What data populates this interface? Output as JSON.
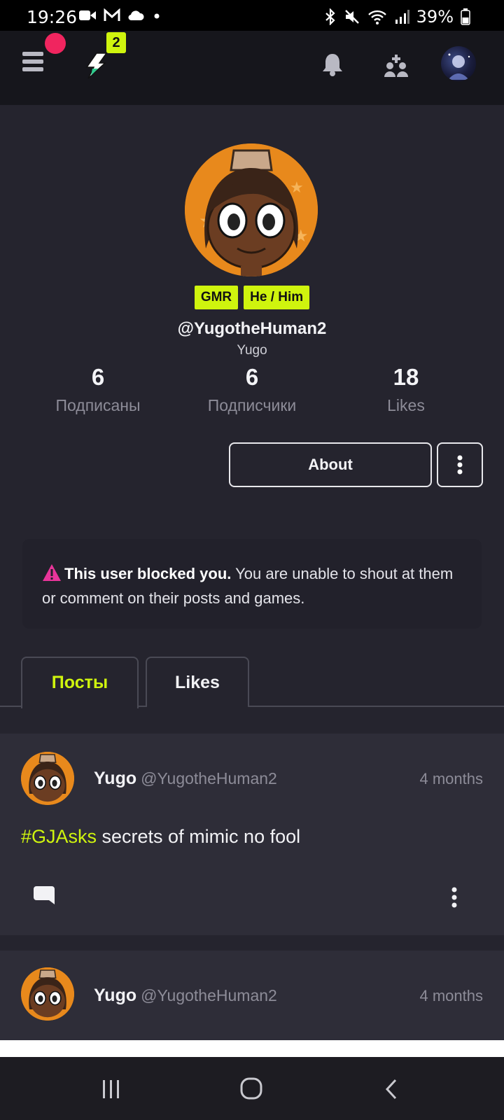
{
  "status_bar": {
    "time": "19:26",
    "battery": "39%"
  },
  "app_header": {
    "notification_badge": "2"
  },
  "profile": {
    "tags": [
      "GMR",
      "He / Him"
    ],
    "handle": "@YugotheHuman2",
    "display_name": "Yugo",
    "stats": [
      {
        "value": "6",
        "label": "Подписаны"
      },
      {
        "value": "6",
        "label": "Подписчики"
      },
      {
        "value": "18",
        "label": "Likes"
      }
    ],
    "about_label": "About"
  },
  "blocked_notice": {
    "bold": "This user blocked you.",
    "text": " You are unable to shout at them or comment on their posts and games."
  },
  "tabs": [
    {
      "label": "Посты",
      "active": true
    },
    {
      "label": "Likes",
      "active": false
    }
  ],
  "posts": [
    {
      "author": "Yugo",
      "handle": "@YugotheHuman2",
      "time": "4 months",
      "hashtag": "#GJAsks",
      "text": " secrets of mimic no fool"
    },
    {
      "author": "Yugo",
      "handle": "@YugotheHuman2",
      "time": "4 months"
    }
  ],
  "colors": {
    "accent": "#cff40e",
    "background": "#25242e",
    "card": "#2e2d38",
    "record_dot": "#f0255f",
    "warning": "#e8359a"
  }
}
